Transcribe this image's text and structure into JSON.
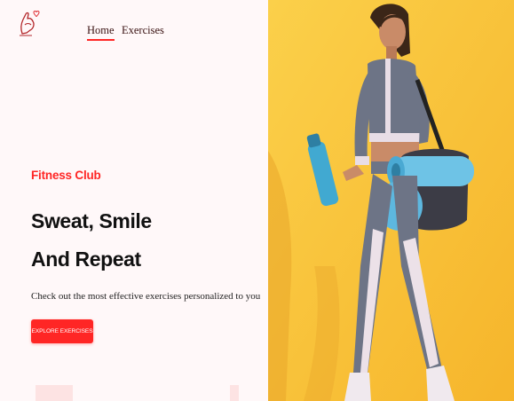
{
  "nav": {
    "logo_icon": "flexed-arm-heart-icon",
    "links": [
      {
        "label": "Home",
        "active": true
      },
      {
        "label": "Exercises",
        "active": false
      }
    ],
    "accent_color": "#ff2625"
  },
  "hero": {
    "tag": "Fitness Club",
    "title_line_1": "Sweat, Smile",
    "title_line_2": "And Repeat",
    "description": "Check out the most effective exercises personalized to you",
    "cta_label": "EXPLORE EXERCISES",
    "image_icon": "woman-with-gym-bag-photo",
    "image_background": "#f8c23a"
  }
}
